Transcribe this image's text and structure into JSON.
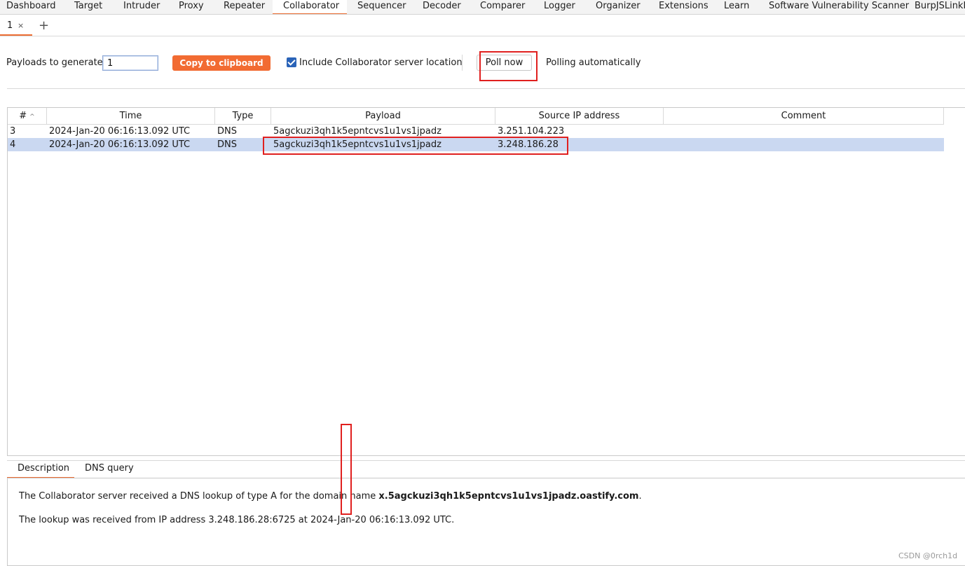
{
  "main_tabs": [
    "Dashboard",
    "Target",
    "Intruder",
    "Proxy",
    "Repeater",
    "Collaborator",
    "Sequencer",
    "Decoder",
    "Comparer",
    "Logger",
    "Organizer",
    "Extensions",
    "Learn",
    "Software Vulnerability Scanner",
    "BurpJSLinkFi"
  ],
  "active_main_tab": "Collaborator",
  "sub_tabs": {
    "tab_label": "1",
    "close_glyph": "×",
    "add_glyph": "+"
  },
  "toolbar": {
    "payloads_label": "Payloads to generate:",
    "payloads_value": "1",
    "copy_label": "Copy to clipboard",
    "include_label": "Include Collaborator server location",
    "include_checked": true,
    "poll_label": "Poll now",
    "polling_status": "Polling automatically"
  },
  "table": {
    "columns": [
      "#",
      "Time",
      "Type",
      "Payload",
      "Source IP address",
      "Comment"
    ],
    "sort_glyph": "^",
    "rows": [
      {
        "num": "3",
        "time": "2024-Jan-20 06:16:13.092 UTC",
        "type": "DNS",
        "payload": "5agckuzi3qh1k5epntcvs1u1vs1jpadz",
        "source_ip": "3.251.104.223",
        "comment": ""
      },
      {
        "num": "4",
        "time": "2024-Jan-20 06:16:13.092 UTC",
        "type": "DNS",
        "payload": "5agckuzi3qh1k5epntcvs1u1vs1jpadz",
        "source_ip": "3.248.186.28",
        "comment": "",
        "selected": true
      }
    ]
  },
  "details": {
    "tabs": [
      "Description",
      "DNS query"
    ],
    "active_tab": "Description",
    "line1_prefix": "The Collaborator server received a DNS lookup of type A for the domain name ",
    "line1_domain": "x.5agckuzi3qh1k5epntcvs1u1vs1jpadz.oastify.com",
    "line1_suffix": ".",
    "line2": "The lookup was received from IP address 3.248.186.28:6725 at 2024-Jan-20 06:16:13.092 UTC."
  },
  "watermark": "CSDN @0rch1d",
  "colors": {
    "accent": "#ec6d33",
    "copy_button": "#f26b32",
    "selection": "#cad8f1",
    "annotation": "#e0201f",
    "checkbox": "#2a63b8"
  }
}
